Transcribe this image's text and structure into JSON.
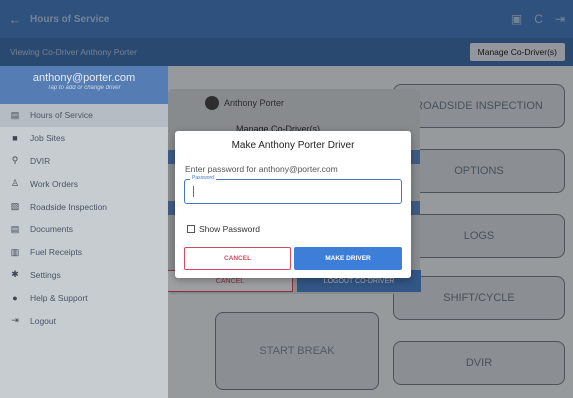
{
  "appbar": {
    "title": "Hours of Service",
    "back_icon": "←",
    "actions": [
      "print-icon",
      "refresh-icon",
      "logout-icon"
    ],
    "action_glyphs": [
      "▣",
      "C",
      "⇥"
    ]
  },
  "subbar": {
    "viewing": "Viewing Co-Driver Anthony Porter",
    "manage_button": "Manage Co-Driver(s)"
  },
  "drawer": {
    "email": "anthony@porter.com",
    "hint": "Tap to add or change driver",
    "items": [
      {
        "label": "Hours of Service",
        "icon": "▤"
      },
      {
        "label": "Job Sites",
        "icon": "■"
      },
      {
        "label": "DVIR",
        "icon": "⚲"
      },
      {
        "label": "Work Orders",
        "icon": "♙"
      },
      {
        "label": "Roadside Inspection",
        "icon": "▧"
      },
      {
        "label": "Documents",
        "icon": "▤"
      },
      {
        "label": "Fuel Receipts",
        "icon": "▥"
      },
      {
        "label": "Settings",
        "icon": "✱"
      },
      {
        "label": "Help & Support",
        "icon": "●"
      },
      {
        "label": "Logout",
        "icon": "⇥"
      }
    ]
  },
  "main": {
    "buttons": [
      "ROADSIDE INSPECTION",
      "OPTIONS",
      "LOGS",
      "SHIFT/CYCLE",
      "DVIR"
    ],
    "start_break": "START BREAK"
  },
  "underlying_dialog": {
    "name": "Anthony Porter",
    "title": "Manage Co-Driver(s)",
    "cancel": "CANCEL",
    "logout": "LOGOUT CO-DRIVER"
  },
  "dialog": {
    "title": "Make Anthony Porter Driver",
    "prompt": "Enter password for anthony@porter.com",
    "field_label": "Password",
    "password_value": "",
    "show_password": "Show Password",
    "cancel": "CANCEL",
    "make_driver": "MAKE DRIVER"
  },
  "colors": {
    "primary": "#4478b9",
    "accent_blue": "#3d7ed9",
    "cancel_red": "#d44a63"
  }
}
